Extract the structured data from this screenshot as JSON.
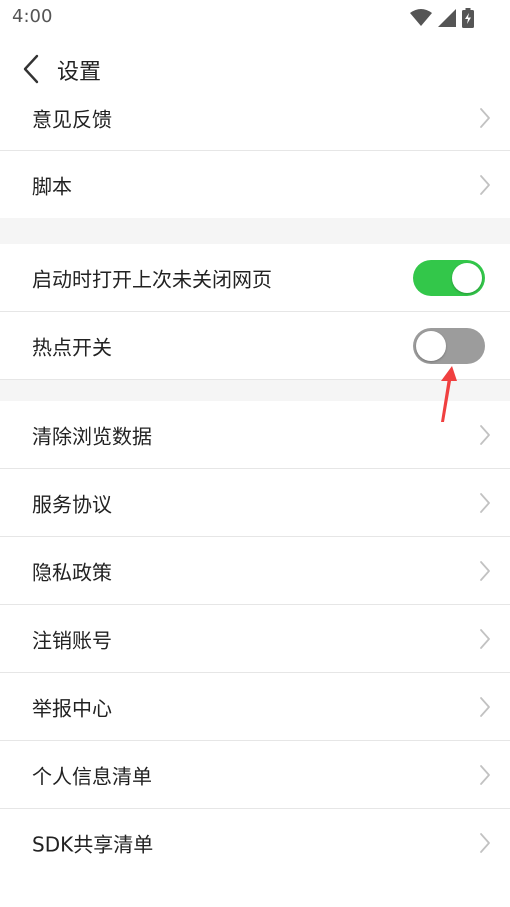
{
  "status_bar": {
    "time": "4:00",
    "icons": [
      "wifi-icon",
      "signal-icon",
      "battery-charging-icon"
    ]
  },
  "header": {
    "back_icon": "chevron-left-icon",
    "title": "设置"
  },
  "settings": {
    "feedback": "意见反馈",
    "script": "脚本",
    "restore_tabs": {
      "label": "启动时打开上次未关闭网页",
      "enabled": true
    },
    "hotspot": {
      "label": "热点开关",
      "enabled": false
    },
    "clear_data": "清除浏览数据",
    "service_agreement": "服务协议",
    "privacy_policy": "隐私政策",
    "cancel_account": "注销账号",
    "report_center": "举报中心",
    "personal_info_list": "个人信息清单",
    "sdk_sharing_list": "SDK共享清单"
  },
  "colors": {
    "toggle_on": "#33c74a",
    "toggle_off": "#9c9c9c",
    "annotation_arrow": "#f04040"
  }
}
